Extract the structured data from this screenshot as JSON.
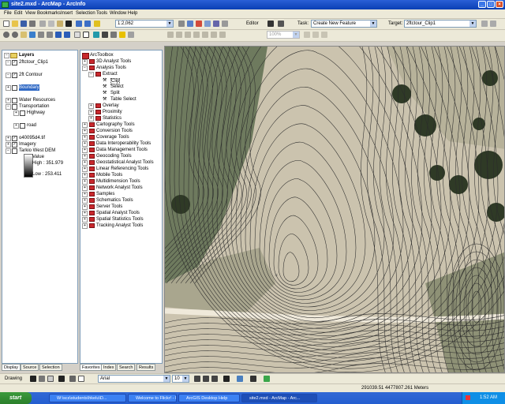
{
  "window": {
    "title": "site2.mxd - ArcMap - ArcInfo"
  },
  "menu": [
    "File",
    "Edit",
    "View",
    "Bookmarks",
    "Insert",
    "Selection",
    "Tools",
    "Window",
    "Help"
  ],
  "toolbar": {
    "scale": "1:2,062",
    "editor_label": "Editor",
    "task_label": "Task:",
    "task_value": "Create New Feature",
    "target_label": "Target:",
    "target_value": "2ftctour_Clip1",
    "zoom_value": "100%"
  },
  "toc": {
    "title": "Layers",
    "items": [
      {
        "label": "2ftctour_Clip1",
        "level": 1,
        "checked": true
      },
      {
        "label": "2ft Contour",
        "level": 1,
        "checked": true
      },
      {
        "label": "Boundary",
        "level": 1,
        "checked": false
      },
      {
        "label": "Water Resources",
        "level": 1,
        "checked": false
      },
      {
        "label": "Transportation",
        "level": 1,
        "checked": false
      },
      {
        "label": "Highway",
        "level": 2,
        "checked": false
      },
      {
        "label": "road",
        "level": 2,
        "checked": false
      },
      {
        "label": "o40095d4.tif",
        "level": 1,
        "checked": true
      },
      {
        "label": "Imagery",
        "level": 1,
        "checked": true
      },
      {
        "label": "Tarkio West DEM",
        "level": 1,
        "checked": false
      },
      {
        "label": "Value",
        "level": 3
      },
      {
        "label": "High : 351.979",
        "level": 3
      },
      {
        "label": "Low : 253.411",
        "level": 3
      }
    ],
    "tabs": [
      "Display",
      "Source",
      "Selection"
    ]
  },
  "toolbox": {
    "title": "ArcToolbox",
    "items": [
      {
        "label": "3D Analyst Tools",
        "level": 1
      },
      {
        "label": "Analysis Tools",
        "level": 1
      },
      {
        "label": "Extract",
        "level": 2
      },
      {
        "label": "Clip",
        "level": 3
      },
      {
        "label": "Select",
        "level": 3
      },
      {
        "label": "Split",
        "level": 3
      },
      {
        "label": "Table Select",
        "level": 3
      },
      {
        "label": "Overlay",
        "level": 2
      },
      {
        "label": "Proximity",
        "level": 2
      },
      {
        "label": "Statistics",
        "level": 2
      },
      {
        "label": "Cartography Tools",
        "level": 1
      },
      {
        "label": "Conversion Tools",
        "level": 1
      },
      {
        "label": "Coverage Tools",
        "level": 1
      },
      {
        "label": "Data Interoperability Tools",
        "level": 1
      },
      {
        "label": "Data Management Tools",
        "level": 1
      },
      {
        "label": "Geocoding Tools",
        "level": 1
      },
      {
        "label": "Geostatistical Analyst Tools",
        "level": 1
      },
      {
        "label": "Linear Referencing Tools",
        "level": 1
      },
      {
        "label": "Mobile Tools",
        "level": 1
      },
      {
        "label": "Multidimension Tools",
        "level": 1
      },
      {
        "label": "Network Analyst Tools",
        "level": 1
      },
      {
        "label": "Samples",
        "level": 1
      },
      {
        "label": "Schematics Tools",
        "level": 1
      },
      {
        "label": "Server Tools",
        "level": 1
      },
      {
        "label": "Spatial Analyst Tools",
        "level": 1
      },
      {
        "label": "Spatial Statistics Tools",
        "level": 1
      },
      {
        "label": "Tracking Analyst Tools",
        "level": 1
      }
    ],
    "tabs": [
      "Favorites",
      "Index",
      "Search",
      "Results"
    ]
  },
  "drawbar": {
    "label": "Drawing",
    "font": "Arial",
    "size": "10"
  },
  "status": {
    "coords": "291039.51  4477807.261 Meters"
  },
  "taskbar": {
    "start": "start",
    "tasks": [
      "W:\\scs\\students\\hkelu\\D...",
      "Welcome to Flickr! - Mozil...",
      "ArcGIS Desktop Help",
      "site2.mxd - ArcMap - Arc..."
    ],
    "time": "1:52 AM"
  },
  "colors": {
    "title_bar": "#0a3fb4",
    "imagery_field": "#cbc3ae",
    "contour": "#2b2b2b",
    "toolbox_icon": "#c8282d"
  }
}
